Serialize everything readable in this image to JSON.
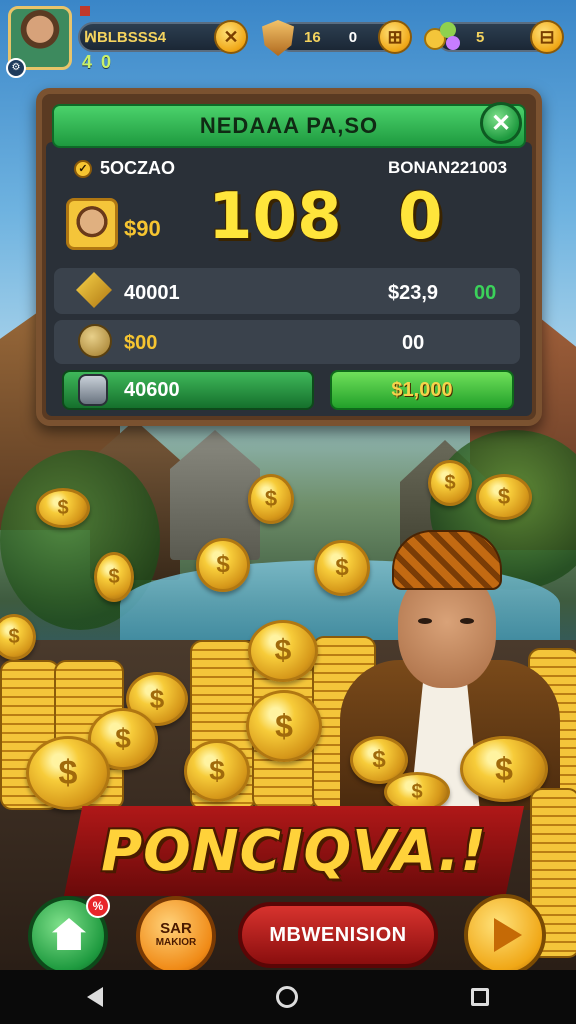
{
  "topbar": {
    "player_name": "ꟽBLBSSS4",
    "level": "4 0",
    "stat1_value": "16",
    "stat2_value": "0",
    "stat3_value": "5",
    "close_glyph": "✕",
    "btn2_glyph": "⊞",
    "btn3_glyph": "⊟"
  },
  "panel": {
    "title": "NEDAAA PA,SO",
    "close_glyph": "✕",
    "row1": {
      "left_label": "5OCZAO",
      "right_label": "BONAN221003"
    },
    "score_row": {
      "amount": "$90",
      "score_big": "108",
      "score_right": "0"
    },
    "row3": {
      "left_value": "40001",
      "right_value": "$23,9",
      "right_extra": "00"
    },
    "row4": {
      "left_value": "$00",
      "right_value": "00"
    },
    "actions": {
      "left_label": "40600",
      "right_label": "$1,000"
    }
  },
  "banner": {
    "text": "PONCIQVA.!"
  },
  "bottom": {
    "notif_count": "%",
    "orange_btn_line1": "SAR",
    "orange_btn_line2": "MAKIOR",
    "red_btn_label": "MBWENISION"
  },
  "coin_symbol": "$",
  "colors": {
    "accent_green": "#1e9a3f",
    "gold": "#f6c531",
    "banner_red": "#b01818"
  }
}
